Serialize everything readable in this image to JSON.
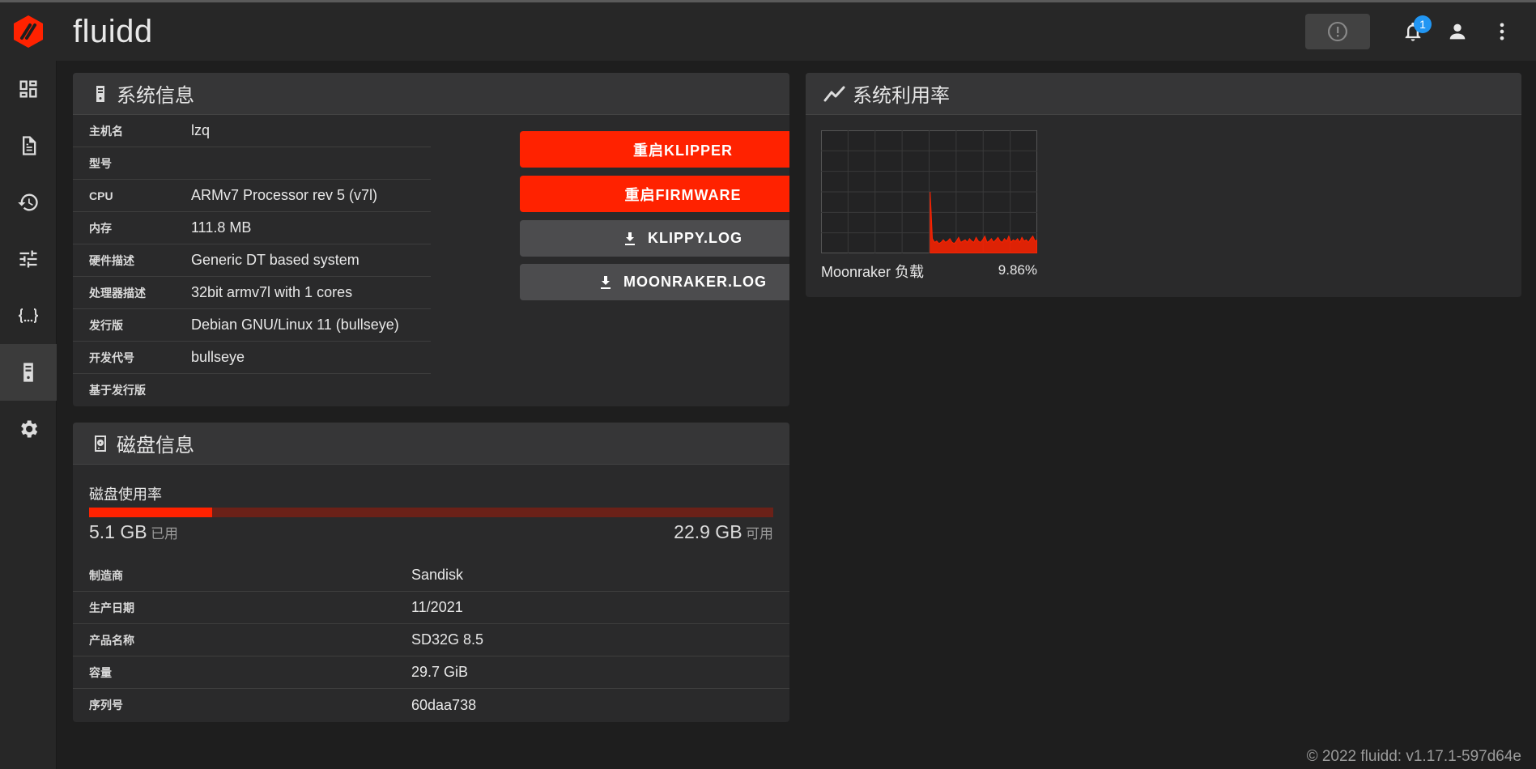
{
  "app": {
    "title": "fluidd"
  },
  "notifications": {
    "count": "1"
  },
  "colors": {
    "accent": "#ff2200",
    "badge": "#2196f3",
    "card": "#2a2a2b",
    "header": "#363637"
  },
  "nav": {
    "items": [
      {
        "icon": "dashboard-icon"
      },
      {
        "icon": "file-document-icon"
      },
      {
        "icon": "history-icon"
      },
      {
        "icon": "tune-icon"
      },
      {
        "icon": "code-braces-icon"
      },
      {
        "icon": "server-icon",
        "active": true
      },
      {
        "icon": "gear-icon"
      }
    ]
  },
  "system_info": {
    "title": "系统信息",
    "rows": [
      {
        "label": "主机名",
        "value": "lzq"
      },
      {
        "label": "型号",
        "value": ""
      },
      {
        "label": "CPU",
        "value": "ARMv7 Processor rev 5 (v7l)"
      },
      {
        "label": "内存",
        "value": "111.8 MB"
      },
      {
        "label": "硬件描述",
        "value": "Generic DT based system"
      },
      {
        "label": "处理器描述",
        "value": "32bit armv7l with 1 cores"
      },
      {
        "label": "发行版",
        "value": "Debian GNU/Linux 11 (bullseye)"
      },
      {
        "label": "开发代号",
        "value": "bullseye"
      },
      {
        "label": "基于发行版",
        "value": ""
      }
    ],
    "buttons": {
      "restart_klipper": "重启KLIPPER",
      "restart_firmware": "重启FIRMWARE",
      "klippy_log": "KLIPPY.LOG",
      "moonraker_log": "MOONRAKER.LOG"
    }
  },
  "utilization": {
    "title": "系统利用率",
    "load_label": "Moonraker 负载",
    "load_value": "9.86%"
  },
  "chart_data": {
    "type": "area",
    "title": "",
    "xlabel": "",
    "ylabel": "",
    "ylim": [
      0,
      100
    ],
    "series": [
      {
        "values": [
          0,
          0,
          0,
          0,
          0,
          0,
          0,
          0,
          0,
          0,
          0,
          0,
          0,
          0,
          0,
          0,
          0,
          0,
          0,
          0,
          0,
          0,
          0,
          0,
          0,
          0,
          0,
          0,
          0,
          0,
          0,
          0,
          0,
          0,
          0,
          0,
          0,
          0,
          0,
          0,
          0,
          0,
          0,
          0,
          0,
          0,
          0,
          0,
          0,
          0,
          50,
          12,
          9,
          10,
          8,
          9,
          11,
          9,
          10,
          12,
          9,
          8,
          10,
          13,
          9,
          10,
          11,
          9,
          12,
          10,
          9,
          13,
          10,
          9,
          11,
          14,
          9,
          10,
          12,
          9,
          11,
          13,
          10,
          9,
          12,
          10,
          14,
          9,
          11,
          10,
          12,
          9,
          13,
          10,
          11,
          9,
          12,
          14,
          10,
          11
        ]
      }
    ]
  },
  "disk_info": {
    "title": "磁盘信息",
    "usage_label": "磁盘使用率",
    "used_fraction": 0.18,
    "used_value": "5.1 GB",
    "used_label": "已用",
    "free_value": "22.9 GB",
    "free_label": "可用",
    "rows": [
      {
        "label": "制造商",
        "value": "Sandisk"
      },
      {
        "label": "生产日期",
        "value": "11/2021"
      },
      {
        "label": "产品名称",
        "value": "SD32G 8.5"
      },
      {
        "label": "容量",
        "value": "29.7 GiB"
      },
      {
        "label": "序列号",
        "value": "60daa738"
      }
    ]
  },
  "footer": {
    "text": "© 2022 fluidd: v1.17.1-597d64e"
  }
}
